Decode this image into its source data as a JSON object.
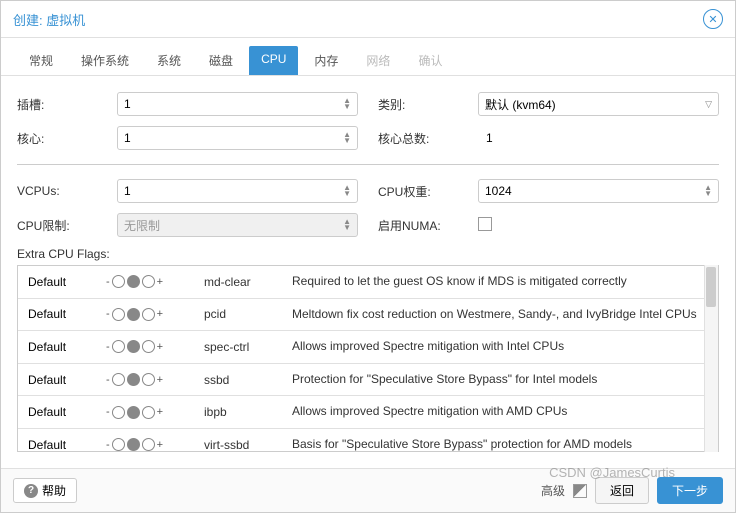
{
  "header": {
    "title": "创建: 虚拟机"
  },
  "tabs": [
    "常规",
    "操作系统",
    "系统",
    "磁盘",
    "CPU",
    "内存",
    "网络",
    "确认"
  ],
  "activeTab": 4,
  "disabledTabs": [
    6,
    7
  ],
  "form": {
    "socketsLabel": "插槽:",
    "socketsVal": "1",
    "coresLabel": "核心:",
    "coresVal": "1",
    "typeLabel": "类别:",
    "typeVal": "默认 (kvm64)",
    "totalLabel": "核心总数:",
    "totalVal": "1",
    "vcpusLabel": "VCPUs:",
    "vcpusVal": "1",
    "weightLabel": "CPU权重:",
    "weightVal": "1024",
    "limitLabel": "CPU限制:",
    "limitVal": "无限制",
    "numaLabel": "启用NUMA:"
  },
  "flagsLabel": "Extra CPU Flags:",
  "flags": [
    {
      "status": "Default",
      "name": "md-clear",
      "desc": "Required to let the guest OS know if MDS is mitigated correctly"
    },
    {
      "status": "Default",
      "name": "pcid",
      "desc": "Meltdown fix cost reduction on Westmere, Sandy-, and IvyBridge Intel CPUs"
    },
    {
      "status": "Default",
      "name": "spec-ctrl",
      "desc": "Allows improved Spectre mitigation with Intel CPUs"
    },
    {
      "status": "Default",
      "name": "ssbd",
      "desc": "Protection for \"Speculative Store Bypass\" for Intel models"
    },
    {
      "status": "Default",
      "name": "ibpb",
      "desc": "Allows improved Spectre mitigation with AMD CPUs"
    },
    {
      "status": "Default",
      "name": "virt-ssbd",
      "desc": "Basis for \"Speculative Store Bypass\" protection for AMD models"
    }
  ],
  "footer": {
    "help": "帮助",
    "advanced": "高级",
    "back": "返回",
    "next": "下一步"
  },
  "watermark": "CSDN @JamesCurtis"
}
